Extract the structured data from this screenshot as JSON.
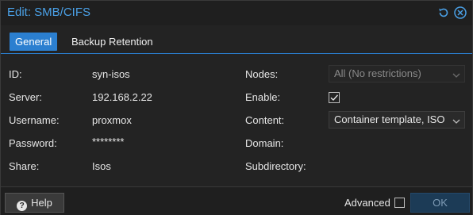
{
  "window": {
    "title": "Edit: SMB/CIFS"
  },
  "titlebar_icons": [
    "reset-icon",
    "close-icon"
  ],
  "tabs": [
    {
      "label": "General",
      "active": true
    },
    {
      "label": "Backup Retention",
      "active": false
    }
  ],
  "form_left": [
    {
      "label": "ID:",
      "value": "syn-isos"
    },
    {
      "label": "Server:",
      "value": "192.168.2.22"
    },
    {
      "label": "Username:",
      "value": "proxmox"
    },
    {
      "label": "Password:",
      "value": "********"
    },
    {
      "label": "Share:",
      "value": "Isos"
    }
  ],
  "form_right": {
    "nodes": {
      "label": "Nodes:",
      "value": "All (No restrictions)"
    },
    "enable": {
      "label": "Enable:",
      "checked": true
    },
    "content": {
      "label": "Content:",
      "value": "Container template, ISO"
    },
    "domain": {
      "label": "Domain:"
    },
    "subdirectory": {
      "label": "Subdirectory:"
    }
  },
  "footer": {
    "help_label": "Help",
    "advanced_label": "Advanced",
    "advanced_checked": false,
    "ok_label": "OK"
  },
  "colors": {
    "accent": "#2b7fd0",
    "title": "#4aa0e6",
    "background": "#232323"
  }
}
